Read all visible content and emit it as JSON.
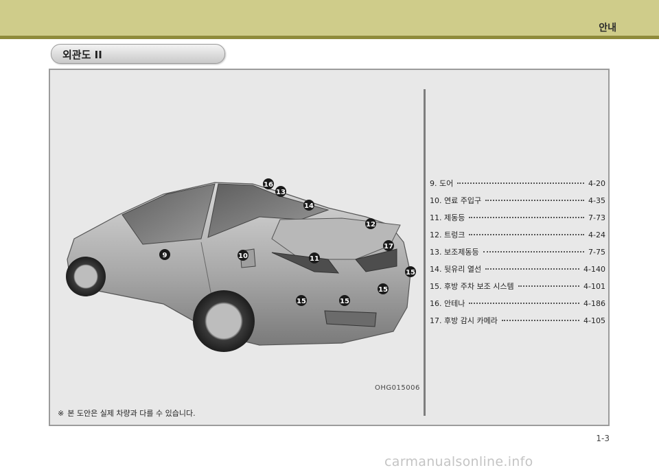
{
  "header": {
    "chapter": "안내"
  },
  "section_title": "외관도 II",
  "figure": {
    "code": "OHG015006",
    "callouts": [
      "9",
      "10",
      "11",
      "12",
      "13",
      "14",
      "15",
      "15",
      "15",
      "15",
      "16",
      "17"
    ]
  },
  "note": {
    "mark": "※",
    "text": "본 도안은 실제 차량과 다를 수 있습니다."
  },
  "toc": [
    {
      "label": "9. 도어",
      "page": "4-20"
    },
    {
      "label": "10. 연료 주입구",
      "page": "4-35"
    },
    {
      "label": "11. 제동등",
      "page": "7-73"
    },
    {
      "label": "12. 트렁크",
      "page": "4-24"
    },
    {
      "label": "13. 보조제동등",
      "page": "7-75"
    },
    {
      "label": "14. 뒷유리 열선",
      "page": "4-140"
    },
    {
      "label": "15. 후방 주차 보조 시스템",
      "page": "4-101"
    },
    {
      "label": "16. 안테나",
      "page": "4-186"
    },
    {
      "label": "17. 후방 감시 카메라",
      "page": "4-105"
    }
  ],
  "page_number": "1-3",
  "watermark": "carmanualsonline.info"
}
